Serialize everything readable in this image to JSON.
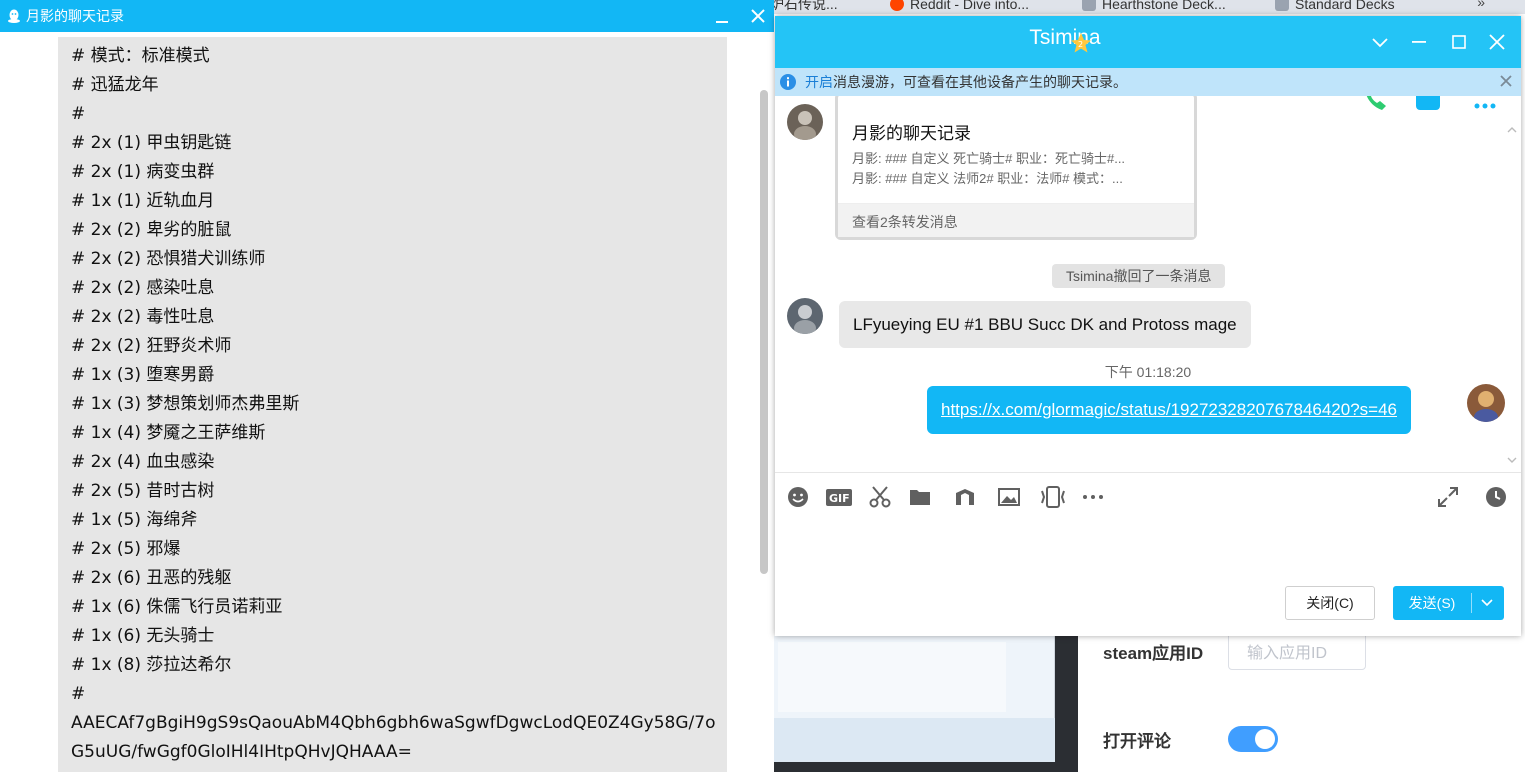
{
  "background": {
    "browser_tabs": [
      {
        "label": "炉石传说...",
        "favicon": "page-icon"
      },
      {
        "label": "Reddit - Dive into...",
        "favicon": "reddit-icon"
      },
      {
        "label": "Hearthstone Deck...",
        "favicon": "page-icon"
      },
      {
        "label": "Standard Decks",
        "favicon": "page-icon"
      }
    ],
    "tabs_overflow": "»",
    "form": {
      "steam_label": "steam应用ID",
      "steam_placeholder": "输入应用ID",
      "comment_label": "打开评论",
      "comment_enabled": true
    }
  },
  "record_window": {
    "title": "月影的聊天记录",
    "lines": [
      "# 模式：标准模式",
      "# 迅猛龙年",
      "#",
      "# 2x (1) 甲虫钥匙链",
      "# 2x (1) 病变虫群",
      "# 1x (1) 近轨血月",
      "# 2x (2) 卑劣的脏鼠",
      "# 2x (2) 恐惧猎犬训练师",
      "# 2x (2) 感染吐息",
      "# 2x (2) 毒性吐息",
      "# 2x (2) 狂野炎术师",
      "# 1x (3) 堕寒男爵",
      "# 1x (3) 梦想策划师杰弗里斯",
      "# 1x (4) 梦魇之王萨维斯",
      "# 2x (4) 血虫感染",
      "# 2x (5) 昔时古树",
      "# 1x (5) 海绵斧",
      "# 2x (5) 邪爆",
      "# 2x (6) 丑恶的残躯",
      "# 1x (6) 侏儒飞行员诺莉亚",
      "# 1x (6) 无头骑士",
      "# 1x (8) 莎拉达希尔",
      "#"
    ],
    "deck_code": "AAECAf7gBgiH9gS9sQaouAbM4Qbh6gbh6waSgwfDgwcLodQE0Z4Gy58G/7oG5uUG/fwGgf0GloIHl4IHtpQHvJQHAAA="
  },
  "chat_window": {
    "title": "Tsimina",
    "accent": "#24c4f6",
    "notice": {
      "link": "开启",
      "text": "消息漫游，可查看在其他设备产生的聊天记录。"
    },
    "forward_card": {
      "title": "月影的聊天记录",
      "lines": [
        "月影: ### 自定义 死亡骑士# 职业：死亡骑士#...",
        "月影: ### 自定义 法师2# 职业：法师# 模式：..."
      ],
      "footer": "查看2条转发消息"
    },
    "recall_notice": "Tsimina撤回了一条消息",
    "incoming_message": "LFyueying EU #1 BBU Succ DK and Protoss mage",
    "time": "下午 01:18:20",
    "outgoing_link": "https://x.com/glormagic/status/1927232820767846420?s=46",
    "buttons": {
      "close": "关闭(C)",
      "send": "发送(S)"
    }
  }
}
